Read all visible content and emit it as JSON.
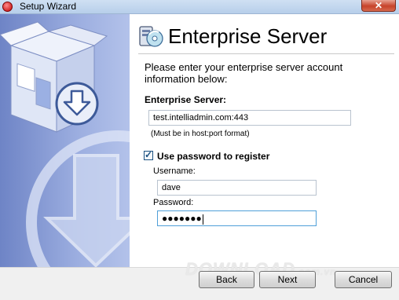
{
  "window": {
    "title": "Setup Wizard",
    "close_glyph": "✕"
  },
  "header": {
    "title": "Enterprise Server",
    "icon": "server-disc-icon"
  },
  "intro": "Please enter your enterprise server account information below:",
  "server": {
    "label": "Enterprise Server:",
    "value": "test.intelliadmin.com:443",
    "hint": "(Must be in host:port format)"
  },
  "use_password": {
    "label": "Use password to register",
    "checked": true
  },
  "username": {
    "label": "Username:",
    "value": "dave"
  },
  "password": {
    "label": "Password:",
    "value": "●●●●●●●"
  },
  "watermark": {
    "main": "DOWNLOAD",
    "sub": ".com.vn"
  },
  "buttons": {
    "back": "Back",
    "next": "Next",
    "cancel": "Cancel"
  },
  "colors": {
    "banner": "#8ea3d9",
    "focus_border": "#4f9fd8",
    "close": "#c7432a"
  }
}
